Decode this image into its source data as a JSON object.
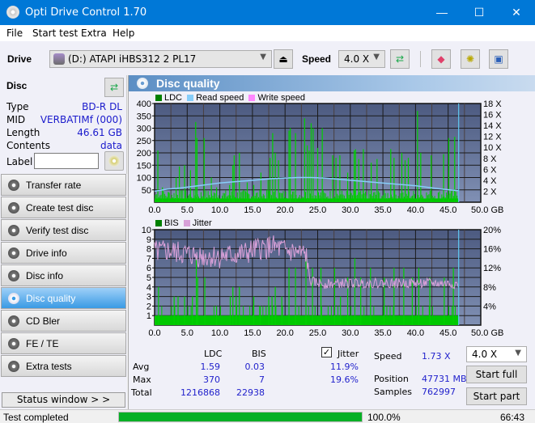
{
  "window": {
    "title": "Opti Drive Control 1.70",
    "minimize": "—",
    "maximize": "☐",
    "close": "✕"
  },
  "menu": [
    "File",
    "Start test",
    "Extra",
    "Help"
  ],
  "toolbar": {
    "drive_label": "Drive",
    "drive_value": "(D:)  ATAPI iHBS312  2 PL17",
    "speed_label": "Speed",
    "speed_value": "4.0 X",
    "icons": [
      "eject-icon",
      "refresh-icon",
      "erase-icon",
      "settings-icon",
      "save-icon"
    ]
  },
  "disc": {
    "title": "Disc",
    "rows": [
      {
        "key": "Type",
        "value": "BD-R DL"
      },
      {
        "key": "MID",
        "value": "VERBATIMf (000)"
      },
      {
        "key": "Length",
        "value": "46.61 GB"
      },
      {
        "key": "Contents",
        "value": "data"
      }
    ],
    "label_key": "Label",
    "label_value": ""
  },
  "nav": [
    {
      "label": "Transfer rate",
      "active": false
    },
    {
      "label": "Create test disc",
      "active": false
    },
    {
      "label": "Verify test disc",
      "active": false
    },
    {
      "label": "Drive info",
      "active": false
    },
    {
      "label": "Disc info",
      "active": false
    },
    {
      "label": "Disc quality",
      "active": true
    },
    {
      "label": "CD Bler",
      "active": false
    },
    {
      "label": "FE / TE",
      "active": false
    },
    {
      "label": "Extra tests",
      "active": false
    }
  ],
  "status_window_label": "Status window > >",
  "panel": {
    "title": "Disc quality"
  },
  "colors": {
    "ldc": "#00cc00",
    "read_speed": "#87cefa",
    "write_speed": "#ff88ff",
    "bis": "#00cc00",
    "jitter": "#d8a0d8",
    "progress": "#06b025"
  },
  "chart_data": [
    {
      "type": "bar",
      "title": "LDC",
      "legend": [
        "LDC",
        "Read speed",
        "Write speed"
      ],
      "xlabel": "GB",
      "x_ticks": [
        "0.0",
        "5.0",
        "10.0",
        "15.0",
        "20.0",
        "25.0",
        "30.0",
        "35.0",
        "40.0",
        "45.0",
        "50.0 GB"
      ],
      "y_ticks_left": [
        "400",
        "350",
        "300",
        "250",
        "200",
        "150",
        "100",
        "50"
      ],
      "y_ticks_right": [
        "18 X",
        "16 X",
        "14 X",
        "12 X",
        "10 X",
        "8 X",
        "6 X",
        "4 X",
        "2 X"
      ],
      "xlim": [
        0,
        50
      ],
      "ylim": [
        0,
        400
      ],
      "y2lim": [
        0,
        18
      ],
      "disc_end_gb": 46.61,
      "ldc_peaks": [
        [
          0.5,
          210
        ],
        [
          1.2,
          60
        ],
        [
          2.2,
          40
        ],
        [
          3.3,
          100
        ],
        [
          3.8,
          145
        ],
        [
          4.6,
          150
        ],
        [
          5.5,
          130
        ],
        [
          6.3,
          325
        ],
        [
          6.5,
          260
        ],
        [
          7.6,
          260
        ],
        [
          8.7,
          100
        ],
        [
          9.5,
          60
        ],
        [
          11.5,
          70
        ],
        [
          12.0,
          150
        ],
        [
          12.2,
          190
        ],
        [
          13.0,
          200
        ],
        [
          14.2,
          80
        ],
        [
          15.2,
          70
        ],
        [
          16.3,
          120
        ],
        [
          17.4,
          90
        ],
        [
          17.7,
          180
        ],
        [
          18.1,
          280
        ],
        [
          18.5,
          200
        ],
        [
          19.0,
          170
        ],
        [
          20.6,
          290
        ],
        [
          20.8,
          300
        ],
        [
          21.6,
          280
        ],
        [
          23.0,
          340
        ],
        [
          23.4,
          230
        ],
        [
          23.7,
          210
        ],
        [
          24.0,
          320
        ],
        [
          24.3,
          300
        ],
        [
          25.0,
          220
        ],
        [
          25.7,
          300
        ],
        [
          27.3,
          190
        ],
        [
          27.8,
          180
        ],
        [
          28.4,
          190
        ],
        [
          29.6,
          120
        ],
        [
          30.6,
          210
        ],
        [
          30.8,
          215
        ],
        [
          31.3,
          175
        ],
        [
          32.0,
          215
        ],
        [
          33.2,
          160
        ],
        [
          34.1,
          175
        ],
        [
          36.2,
          215
        ],
        [
          36.7,
          180
        ],
        [
          37.9,
          200
        ],
        [
          38.4,
          170
        ],
        [
          38.9,
          180
        ],
        [
          40.3,
          370
        ],
        [
          40.8,
          200
        ],
        [
          42.4,
          190
        ],
        [
          44.3,
          195
        ],
        [
          45.1,
          260
        ],
        [
          46.0,
          265
        ]
      ],
      "ldc_baseline": 15,
      "read_speed_x": [
        [
          0,
          2.0
        ],
        [
          2,
          2.4
        ],
        [
          4,
          2.6
        ],
        [
          6,
          2.9
        ],
        [
          8,
          3.2
        ],
        [
          10,
          3.5
        ],
        [
          12,
          3.7
        ],
        [
          14,
          3.9
        ],
        [
          16,
          4.1
        ],
        [
          18,
          4.3
        ],
        [
          20,
          4.4
        ],
        [
          22,
          4.5
        ],
        [
          24,
          4.5
        ],
        [
          26,
          4.4
        ],
        [
          28,
          4.2
        ],
        [
          30,
          4.0
        ],
        [
          32,
          3.8
        ],
        [
          34,
          3.6
        ],
        [
          36,
          3.4
        ],
        [
          38,
          3.2
        ],
        [
          40,
          3.0
        ],
        [
          42,
          2.7
        ],
        [
          44,
          2.4
        ],
        [
          46.6,
          2.1
        ]
      ]
    },
    {
      "type": "bar",
      "title": "BIS / Jitter",
      "legend": [
        "BIS",
        "Jitter"
      ],
      "xlabel": "GB",
      "x_ticks": [
        "0.0",
        "5.0",
        "10.0",
        "15.0",
        "20.0",
        "25.0",
        "30.0",
        "35.0",
        "40.0",
        "45.0",
        "50.0 GB"
      ],
      "y_ticks_left": [
        "10",
        "9",
        "8",
        "7",
        "6",
        "5",
        "4",
        "3",
        "2",
        "1"
      ],
      "y_ticks_right": [
        "20%",
        "16%",
        "12%",
        "8%",
        "4%"
      ],
      "xlim": [
        0,
        50
      ],
      "ylim": [
        0,
        10
      ],
      "y2lim": [
        0,
        20
      ],
      "bis_peaks": [
        [
          0.6,
          4
        ],
        [
          3.0,
          3
        ],
        [
          3.6,
          3
        ],
        [
          4.6,
          3
        ],
        [
          5.8,
          3
        ],
        [
          6.4,
          7
        ],
        [
          6.6,
          5
        ],
        [
          7.7,
          5
        ],
        [
          9.5,
          2
        ],
        [
          11.6,
          3
        ],
        [
          12.0,
          4
        ],
        [
          12.5,
          3
        ],
        [
          13.0,
          4
        ],
        [
          15.2,
          3
        ],
        [
          16.2,
          2
        ],
        [
          17.5,
          3
        ],
        [
          18.0,
          3
        ],
        [
          18.5,
          4
        ],
        [
          19.5,
          3
        ],
        [
          20.6,
          6
        ],
        [
          21.6,
          6
        ],
        [
          23.2,
          7
        ],
        [
          24.2,
          6
        ],
        [
          25.5,
          6
        ],
        [
          27.6,
          6
        ],
        [
          28.5,
          3
        ],
        [
          29.6,
          5
        ],
        [
          30.7,
          7
        ],
        [
          31.6,
          5
        ],
        [
          33.1,
          6
        ],
        [
          35.2,
          5
        ],
        [
          36.7,
          6
        ],
        [
          38.2,
          6
        ],
        [
          39.5,
          5
        ],
        [
          40.5,
          6
        ],
        [
          42.2,
          5
        ],
        [
          44.4,
          5
        ],
        [
          45.8,
          6
        ]
      ],
      "bis_baseline": 1,
      "jitter_percent": [
        [
          0,
          15.2
        ],
        [
          2,
          15.5
        ],
        [
          4,
          15.0
        ],
        [
          6,
          14.6
        ],
        [
          8,
          14.4
        ],
        [
          10,
          14.4
        ],
        [
          12,
          14.6
        ],
        [
          14,
          15.0
        ],
        [
          16,
          16.0
        ],
        [
          18,
          16.4
        ],
        [
          20,
          15.6
        ],
        [
          22,
          15.0
        ],
        [
          23.3,
          14.6
        ],
        [
          23.8,
          9.2
        ],
        [
          26,
          8.6
        ],
        [
          30,
          8.8
        ],
        [
          34,
          8.8
        ],
        [
          38,
          8.8
        ],
        [
          42,
          8.8
        ],
        [
          46.6,
          8.6
        ]
      ]
    }
  ],
  "stats": {
    "headers": [
      "LDC",
      "BIS"
    ],
    "jitter_checkbox_label": "Jitter",
    "jitter_checked": true,
    "rows": [
      {
        "label": "Avg",
        "ldc": "1.59",
        "bis": "0.03",
        "jitter": "11.9%"
      },
      {
        "label": "Max",
        "ldc": "370",
        "bis": "7",
        "jitter": "19.6%"
      },
      {
        "label": "Total",
        "ldc": "1216868",
        "bis": "22938",
        "jitter": ""
      }
    ],
    "speed_label": "Speed",
    "speed_value": "1.73 X",
    "position_label": "Position",
    "position_value": "47731 MB",
    "samples_label": "Samples",
    "samples_value": "762997",
    "speed_select": "4.0 X",
    "start_full": "Start full",
    "start_part": "Start part"
  },
  "statusbar": {
    "text": "Test completed",
    "progress_percent": 100.0,
    "progress_label": "100.0%",
    "time": "66:43"
  }
}
